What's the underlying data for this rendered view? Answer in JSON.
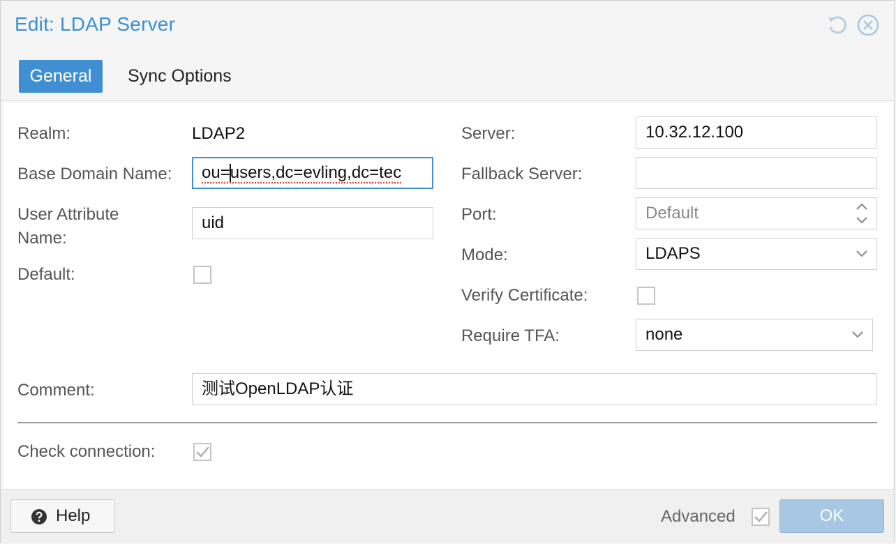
{
  "dialog": {
    "title": "Edit: LDAP Server",
    "accent_color": "#3f8fd2",
    "tools": [
      {
        "icon": "reset-icon"
      },
      {
        "icon": "close-icon"
      }
    ]
  },
  "tabs": [
    {
      "label": "General",
      "active": true
    },
    {
      "label": "Sync Options",
      "active": false
    }
  ],
  "left": {
    "realm": {
      "label": "Realm:",
      "value": "LDAP2"
    },
    "base_dn": {
      "label": "Base Domain Name:",
      "value_before_caret": "ou=",
      "value_after_caret": "users,dc=evling,dc=tec"
    },
    "user_attr": {
      "label": "User Attribute Name:",
      "value": "uid"
    },
    "default": {
      "label": "Default:",
      "checked": false
    }
  },
  "right": {
    "server": {
      "label": "Server:",
      "value": "10.32.12.100"
    },
    "fallback": {
      "label": "Fallback Server:",
      "value": ""
    },
    "port": {
      "label": "Port:",
      "placeholder": "Default"
    },
    "mode": {
      "label": "Mode:",
      "value": "LDAPS"
    },
    "verify_cert": {
      "label": "Verify Certificate:",
      "checked": false
    },
    "require_tfa": {
      "label": "Require TFA:",
      "value": "none"
    }
  },
  "comment": {
    "label": "Comment:",
    "value": "测试OpenLDAP认证"
  },
  "check_connection": {
    "label": "Check connection:",
    "checked": true
  },
  "footer": {
    "help_label": "Help",
    "advanced_label": "Advanced",
    "advanced_checked": true,
    "ok_label": "OK"
  }
}
